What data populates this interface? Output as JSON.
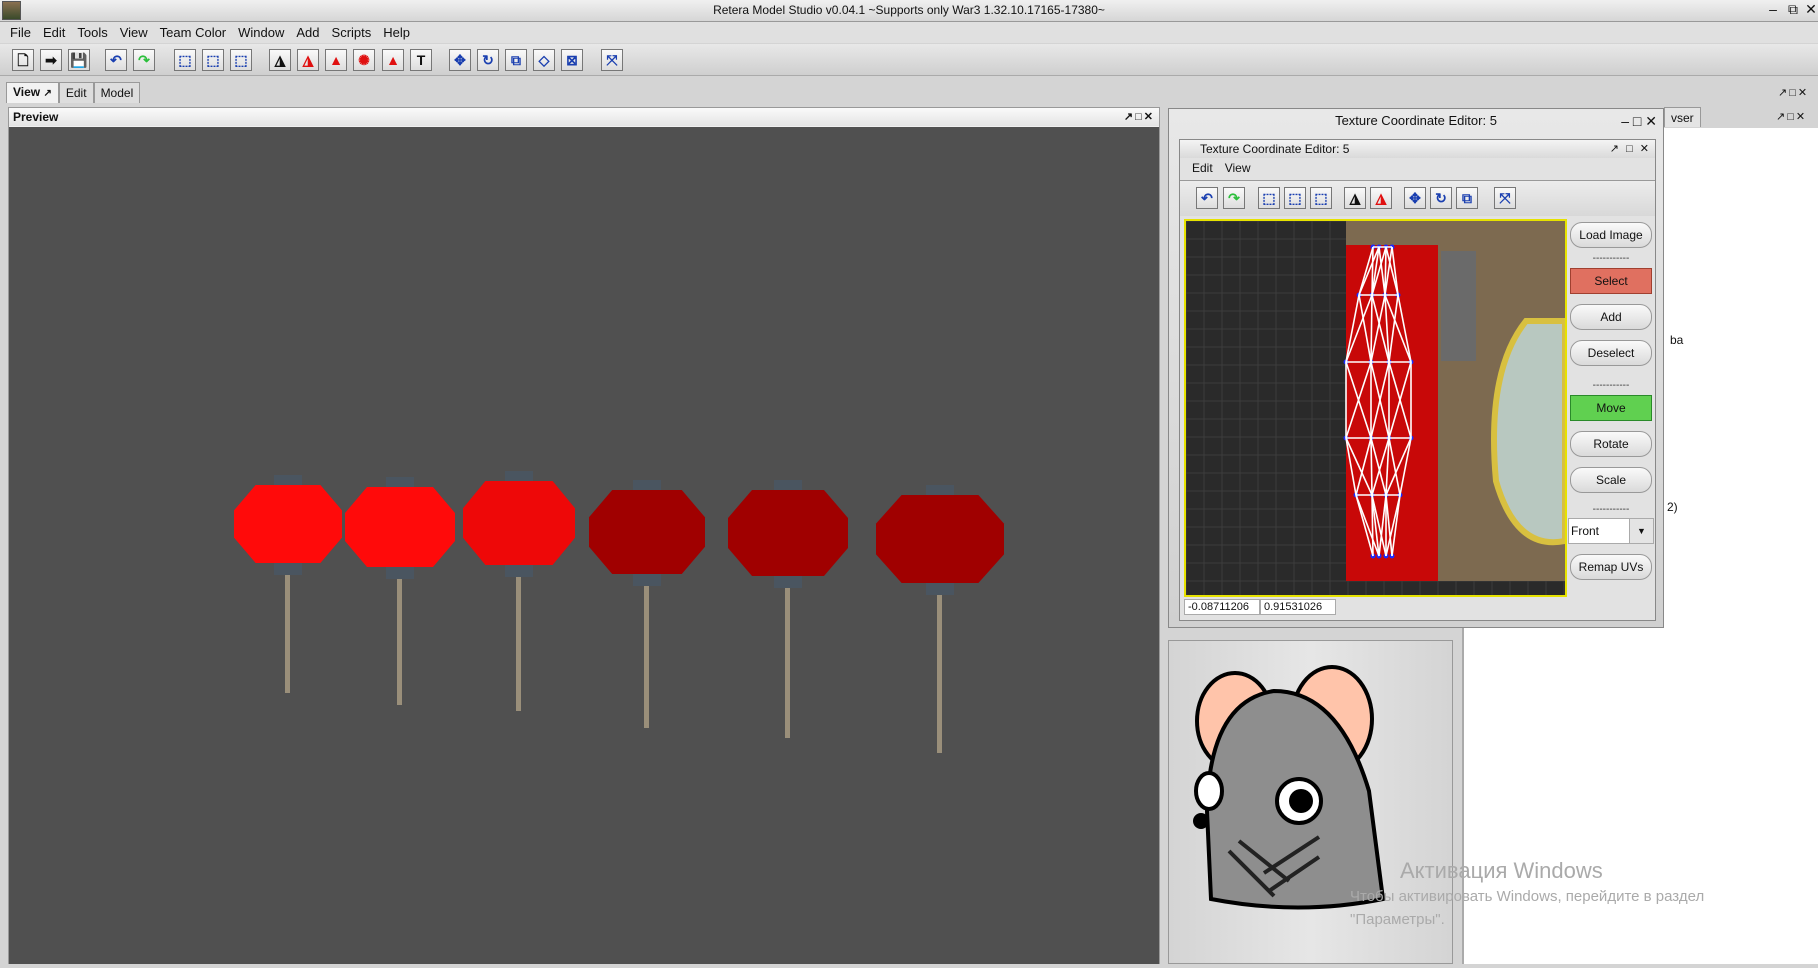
{
  "window": {
    "title": "Retera Model Studio v0.04.1 ~Supports only War3 1.32.10.17165-17380~",
    "minimize": "–",
    "restore": "⧉",
    "close": "✕"
  },
  "menu": [
    "File",
    "Edit",
    "Tools",
    "View",
    "Team Color",
    "Window",
    "Add",
    "Scripts",
    "Help"
  ],
  "toolbar": [
    {
      "icon": "new-file-icon",
      "glyph": "🗋"
    },
    {
      "icon": "open-file-icon",
      "glyph": "➡"
    },
    {
      "icon": "save-icon",
      "glyph": "💾"
    },
    {
      "icon": "undo-icon",
      "glyph": "↶"
    },
    {
      "icon": "redo-icon",
      "glyph": "↷"
    },
    {
      "icon": "select-icon",
      "glyph": "⬚"
    },
    {
      "icon": "select-add-icon",
      "glyph": "⬚"
    },
    {
      "icon": "select-remove-icon",
      "glyph": "⬚"
    },
    {
      "icon": "vertex-mode-icon",
      "glyph": "◮"
    },
    {
      "icon": "face-mode-icon",
      "glyph": "◮"
    },
    {
      "icon": "group-mode-icon",
      "glyph": "▲"
    },
    {
      "icon": "particle-mode-icon",
      "glyph": "✺"
    },
    {
      "icon": "triangle-mode-icon",
      "glyph": "▲"
    },
    {
      "icon": "text-icon",
      "glyph": "T"
    },
    {
      "icon": "move-icon",
      "glyph": "✥"
    },
    {
      "icon": "rotate-icon",
      "glyph": "↻"
    },
    {
      "icon": "scale-icon",
      "glyph": "⧉"
    },
    {
      "icon": "extrude-icon",
      "glyph": "◇"
    },
    {
      "icon": "extend-icon",
      "glyph": "⊠"
    },
    {
      "icon": "snap-icon",
      "glyph": "⤧"
    }
  ],
  "tabs": [
    {
      "label": "View",
      "pin": "↗"
    },
    {
      "label": "Edit"
    },
    {
      "label": "Model"
    }
  ],
  "preview": {
    "title": "Preview",
    "controls": "↗□✕"
  },
  "lanterns": [
    {
      "color": "#ff0a0a"
    },
    {
      "color": "#ff0a0a"
    },
    {
      "color": "#ee0808"
    },
    {
      "color": "#a00000"
    },
    {
      "color": "#a00000"
    },
    {
      "color": "#a00000"
    }
  ],
  "tce": {
    "title": "Texture Coordinate Editor: 5",
    "controls": "–  □  ✕",
    "inner_title": "Texture Coordinate Editor: 5",
    "inner_controls": "↗ □ ✕",
    "menu": [
      "Edit",
      "View"
    ],
    "toolbar": [
      "undo-icon",
      "redo-icon",
      "select-icon",
      "select-add-icon",
      "select-remove-icon",
      "vertex-mode-icon",
      "face-mode-icon",
      "move-icon",
      "rotate-icon",
      "scale-icon",
      "snap-icon"
    ],
    "buttons": {
      "load_image": "Load Image",
      "sep": "-----------",
      "select": "Select",
      "add": "Add",
      "deselect": "Deselect",
      "move": "Move",
      "rotate": "Rotate",
      "scale": "Scale",
      "remap": "Remap UVs"
    },
    "view_select": "Front",
    "coords": [
      "-0.08711206",
      "0.91531026"
    ],
    "colors": {
      "select": "#e07060",
      "move": "#60d050",
      "border": "#e6e200"
    }
  },
  "right": {
    "tab_fragment": "vser",
    "controls": "↗□✕",
    "text1": "ba",
    "text2": "2)"
  },
  "watermark": {
    "line1": "Активация Windows",
    "line2": "Чтобы активировать Windows, перейдите в раздел",
    "line3": "\"Параметры\"."
  }
}
